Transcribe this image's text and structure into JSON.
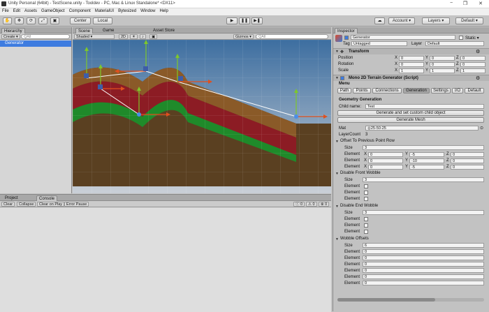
{
  "window": {
    "title": "Unity Personal (64bit) - TestScene.unity - Tooldev - PC, Mac & Linux Standalone* <DX11>",
    "minimize": "−",
    "maximize": "❐",
    "close": "✕"
  },
  "menu": [
    "File",
    "Edit",
    "Assets",
    "GameObject",
    "Component",
    "MaterialUI",
    "Bytesized",
    "Window",
    "Help"
  ],
  "toolbar": {
    "pivot": "Center",
    "space": "Local",
    "play": "▶",
    "pause": "❚❚",
    "step": "▶❚",
    "cloud": "☁",
    "account": "Account ▾",
    "layers": "Layers ▾",
    "layout": "Default ▾",
    "tools": [
      "✋",
      "✥",
      "⟳",
      "⤢",
      "▣"
    ]
  },
  "hierarchy": {
    "tab": "Hierarchy",
    "create": "Create ▾",
    "search_placeholder": "Q‍All",
    "items": [
      "Generator"
    ]
  },
  "scene": {
    "tabs": [
      "Scene",
      "Game",
      "Asset Store"
    ],
    "shading": "Shaded ▾",
    "mode2d": "2D",
    "gizmos": "Gizmos ▾",
    "search_placeholder": "Q‍All"
  },
  "bottom": {
    "tabs": [
      "Project",
      "Console"
    ],
    "buttons": [
      "Clear",
      "Collapse",
      "Clear on Play",
      "Error Pause"
    ],
    "counters": [
      "0",
      "0",
      "0"
    ]
  },
  "inspector": {
    "tab": "Inspector",
    "object_name": "Generator",
    "static_label": "Static ▾",
    "tag_label": "Tag",
    "tag_value": "Untagged",
    "layer_label": "Layer",
    "layer_value": "Default",
    "transform": {
      "title": "Transform",
      "rows": [
        {
          "label": "Position",
          "x": "0",
          "y": "0",
          "z": "0"
        },
        {
          "label": "Rotation",
          "x": "0",
          "y": "0",
          "z": "0"
        },
        {
          "label": "Scale",
          "x": "1",
          "y": "1",
          "z": "1"
        }
      ]
    },
    "script": {
      "title": "Mono 2D Terrain Generator (Script)",
      "menu_label": "Menu",
      "menu_tabs": [
        "Path",
        "Points",
        "Connections",
        "Generation",
        "Settings",
        "I/O",
        "Default"
      ],
      "geom_title": "Geometry Generation",
      "child_name_label": "Child name:",
      "child_name_value": "Test",
      "gen_custom_button": "Generate and set custom child object",
      "gen_mesh_button": "Generate Mesh",
      "mat_label": "Mat",
      "mat_value": "25-50-25",
      "layercount_label": "LayerCount",
      "layercount_value": "3",
      "offset_title": "Offset To Previous Point Row",
      "size_label": "Size",
      "offset_size": "3",
      "offset_rows": [
        {
          "label": "Element",
          "x": "0",
          "y": "-5",
          "z": "0"
        },
        {
          "label": "Element",
          "x": "0",
          "y": "-10",
          "z": "0"
        },
        {
          "label": "Element",
          "x": "0",
          "y": "-5",
          "z": "0"
        }
      ],
      "front_title": "Disable Front Wobble",
      "front_size": "3",
      "front_rows": [
        "Element",
        "Element",
        "Element"
      ],
      "end_title": "Disable End Wobble",
      "end_size": "3",
      "end_rows": [
        "Element",
        "Element",
        "Element"
      ],
      "wobble_title": "Wobble Offsets",
      "wobble_size": "6",
      "wobble_rows": [
        {
          "label": "Element",
          "value": "0"
        },
        {
          "label": "Element",
          "value": "0"
        },
        {
          "label": "Element",
          "value": "0"
        },
        {
          "label": "Element",
          "value": "0"
        },
        {
          "label": "Element",
          "value": "0"
        },
        {
          "label": "Element",
          "value": "0"
        }
      ]
    }
  },
  "colors": {
    "sky_top": "#3d6ea0",
    "sky_bottom": "#c9cfd6",
    "ground": "#5a4021",
    "red_layer": "#8c1c24",
    "green_layer": "#1f8a2a",
    "selection": "#3e7ce0"
  }
}
